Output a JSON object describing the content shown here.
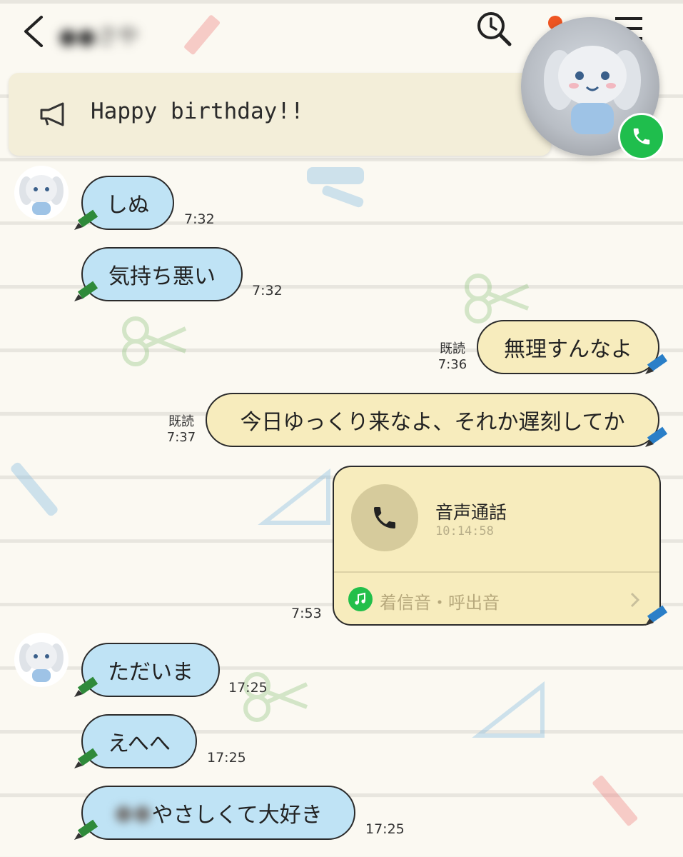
{
  "header": {
    "contact_name": "●●さや",
    "icons": [
      "back-icon",
      "search-icon",
      "menu-icon"
    ]
  },
  "announcement": {
    "text": "Happy birthday!!",
    "icon": "megaphone-icon"
  },
  "call_overlay": {
    "icon": "phone-icon",
    "button_color": "#1fbe4d"
  },
  "messages": [
    {
      "side": "in",
      "text": "しぬ",
      "time": "7:32"
    },
    {
      "side": "in",
      "text": "気持ち悪い",
      "time": "7:32"
    },
    {
      "side": "out",
      "text": "無理すんなよ",
      "read": "既読",
      "time": "7:36"
    },
    {
      "side": "out",
      "text": "今日ゆっくり来なよ、それか遅刻してか",
      "read": "既読",
      "time": "7:37"
    },
    {
      "side": "out",
      "type": "call",
      "title": "音声通話",
      "duration": "10:14:58",
      "ringtone_label": "着信音・呼出音",
      "time": "7:53"
    },
    {
      "side": "in",
      "text": "ただいま",
      "time": "17:25"
    },
    {
      "side": "in",
      "text": "えへへ",
      "time": "17:25"
    },
    {
      "side": "in",
      "text_hidden": "●●",
      "text": "やさしくて大好き",
      "time": "17:25"
    }
  ],
  "colors": {
    "incoming_bubble": "#bfe3f5",
    "outgoing_bubble": "#f7ecbd",
    "accent_green": "#1fbe4d",
    "background": "#fbf9f2"
  }
}
